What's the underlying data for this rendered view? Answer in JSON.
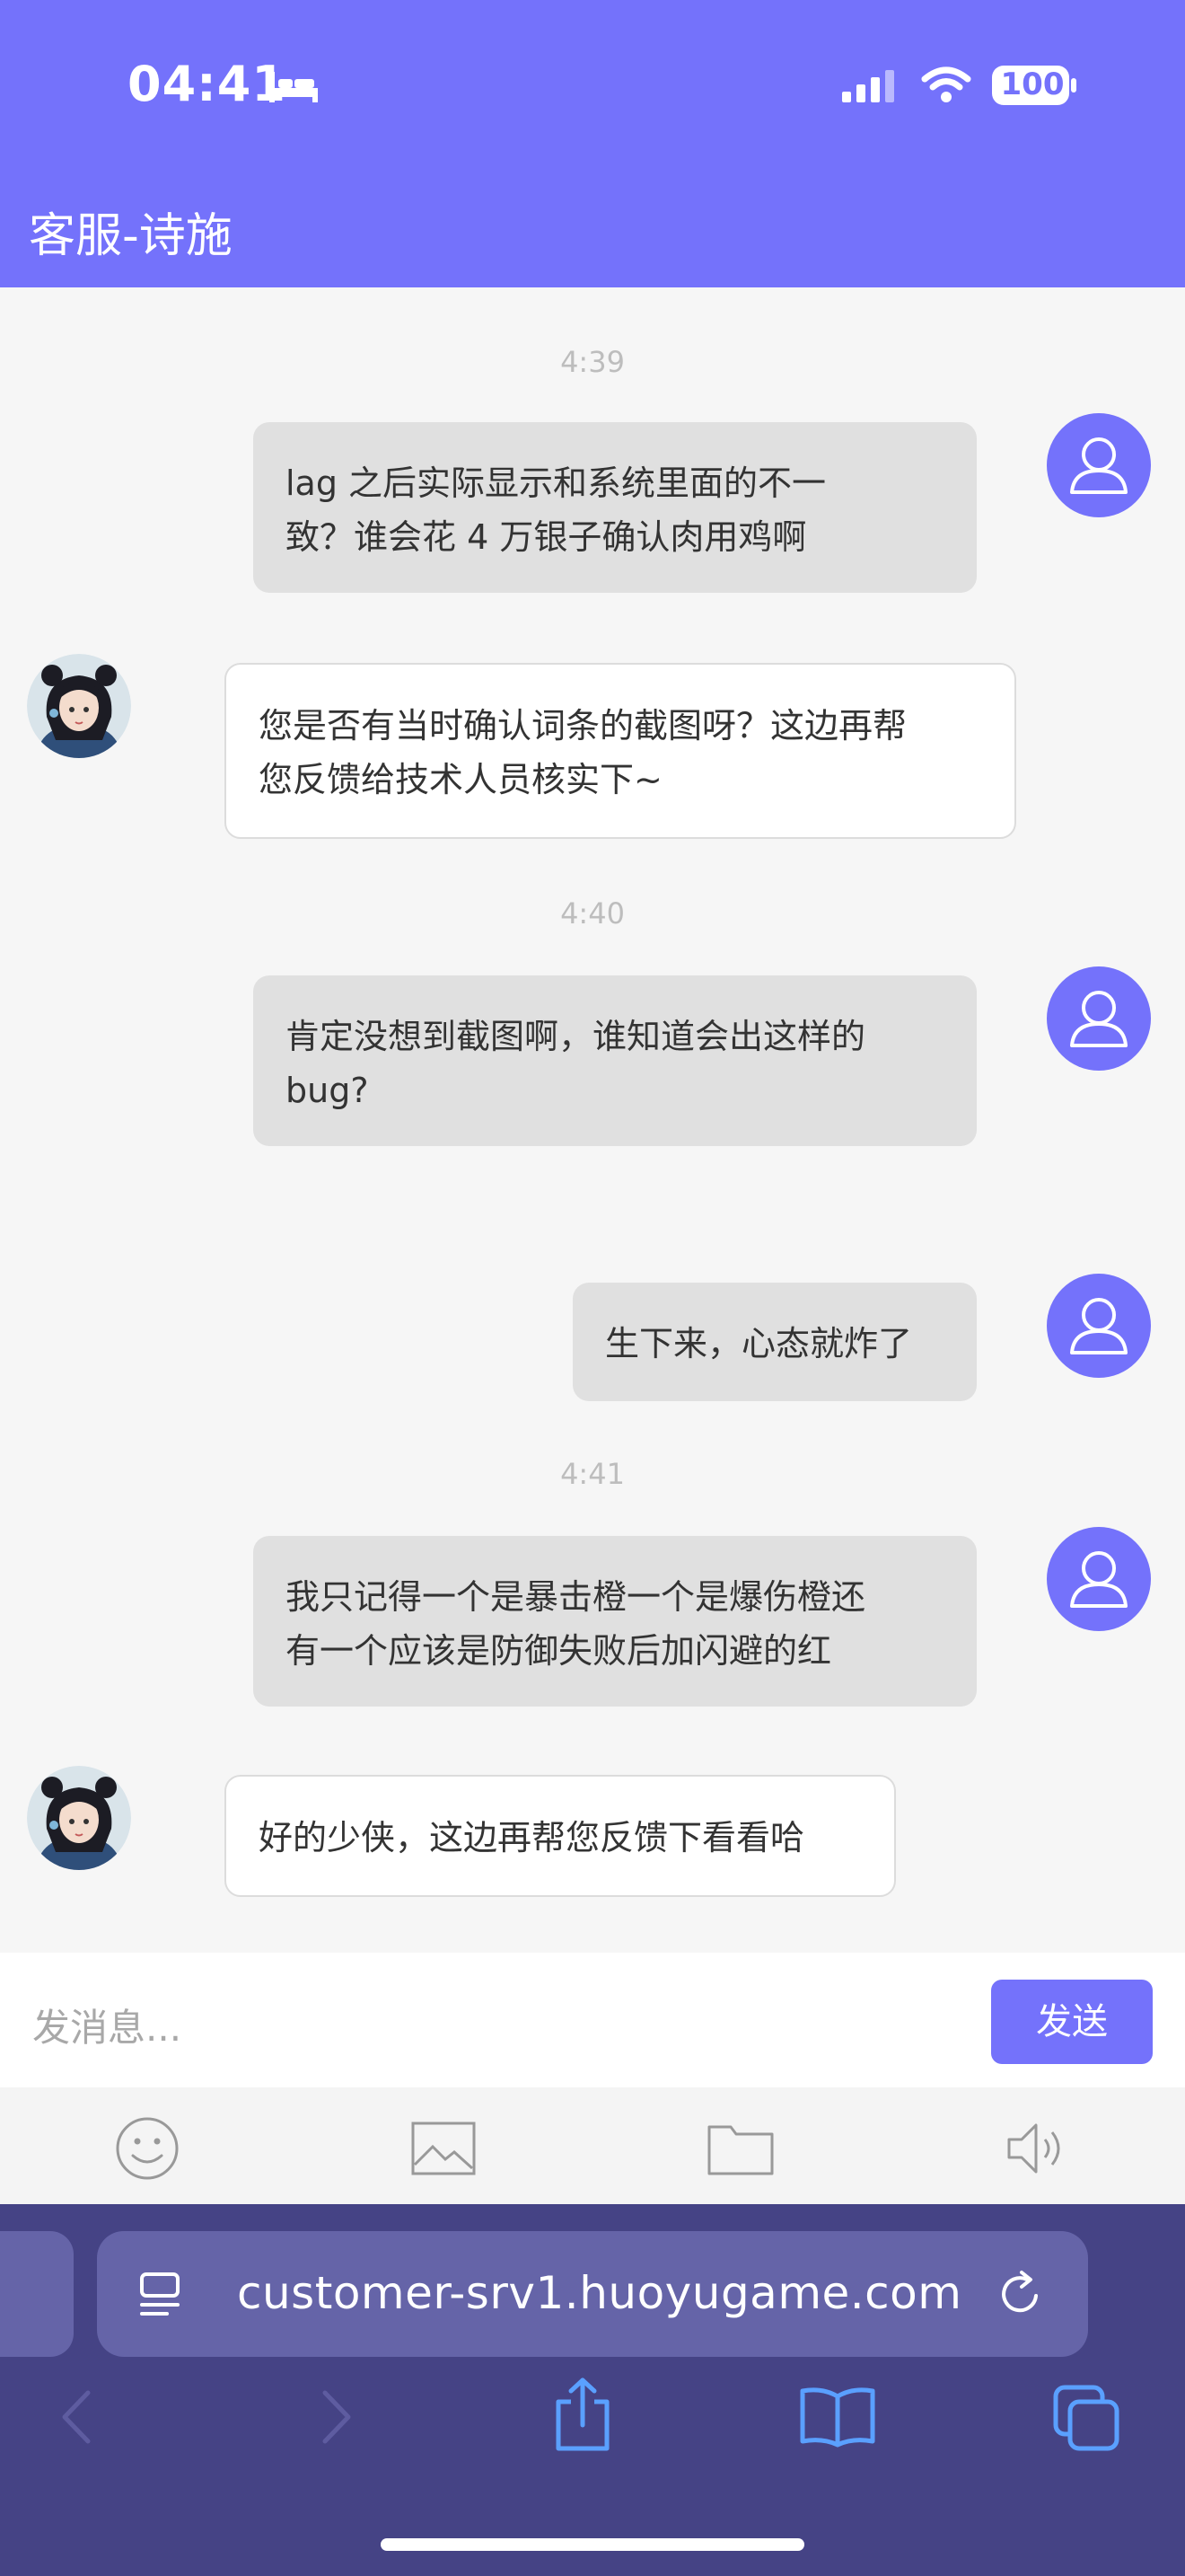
{
  "status_bar": {
    "time": "04:41",
    "battery": "100"
  },
  "header": {
    "title": "客服-诗施"
  },
  "messages": [
    {
      "type": "stamp",
      "text": "4:39"
    },
    {
      "type": "user",
      "text": "lag 之后实际显示和系统里面的不一\n致？谁会花 4 万银子确认肉用鸡啊"
    },
    {
      "type": "agent",
      "text": "您是否有当时确认词条的截图呀？这边再帮\n您反馈给技术人员核实下~"
    },
    {
      "type": "stamp",
      "text": "4:40"
    },
    {
      "type": "user",
      "text": "肯定没想到截图啊，谁知道会出这样的\nbug?"
    },
    {
      "type": "user",
      "text": "生下来，心态就炸了"
    },
    {
      "type": "stamp",
      "text": "4:41"
    },
    {
      "type": "user",
      "text": "我只记得一个是暴击橙一个是爆伤橙还\n有一个应该是防御失败后加闪避的红"
    },
    {
      "type": "agent",
      "text": "好的少侠，这边再帮您反馈下看看哈"
    }
  ],
  "input": {
    "placeholder": "发消息...",
    "send_label": "发送"
  },
  "toolbar": {
    "icons": [
      "emoji-icon",
      "image-icon",
      "folder-icon",
      "voice-icon"
    ]
  },
  "browser": {
    "url": "customer-srv1.huoyugame.com"
  },
  "colors": {
    "accent": "#7472fb",
    "browser_bar": "#454385",
    "user_bubble": "#e0e0e0"
  }
}
